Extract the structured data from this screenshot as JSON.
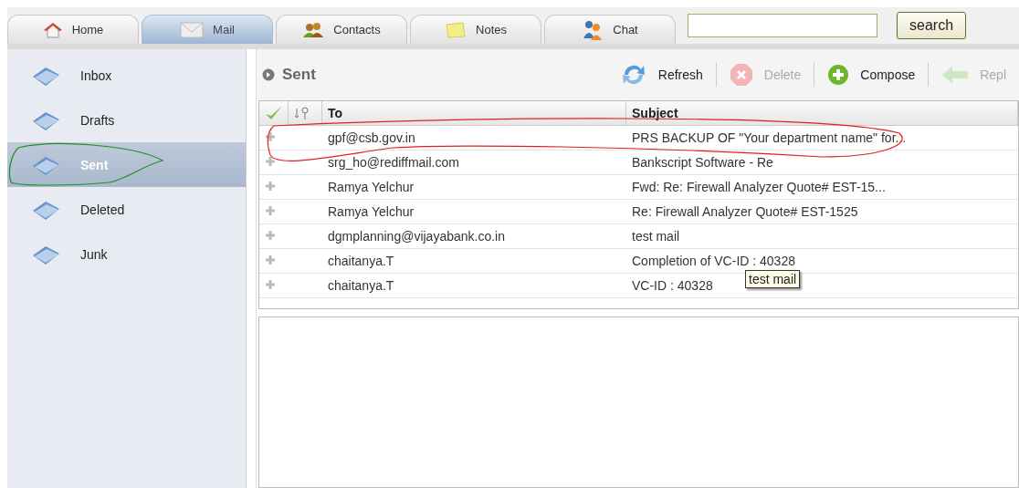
{
  "tabs": [
    {
      "label": "Home",
      "kind": "home",
      "selected": false
    },
    {
      "label": "Mail",
      "kind": "mail",
      "selected": true
    },
    {
      "label": "Contacts",
      "kind": "contacts",
      "selected": false
    },
    {
      "label": "Notes",
      "kind": "notes",
      "selected": false
    },
    {
      "label": "Chat",
      "kind": "chat",
      "selected": false
    }
  ],
  "search": {
    "button": "search"
  },
  "folders": [
    {
      "label": "Inbox",
      "selected": false
    },
    {
      "label": "Drafts",
      "selected": false
    },
    {
      "label": "Sent",
      "selected": true
    },
    {
      "label": "Deleted",
      "selected": false
    },
    {
      "label": "Junk",
      "selected": false
    }
  ],
  "panel_title": "Sent",
  "toolbar": [
    {
      "label": "Refresh",
      "kind": "refresh",
      "disabled": false
    },
    {
      "label": "Delete",
      "kind": "delete",
      "disabled": true
    },
    {
      "label": "Compose",
      "kind": "compose",
      "disabled": false
    },
    {
      "label": "Repl",
      "kind": "reply",
      "disabled": true
    }
  ],
  "table": {
    "columns": [
      "To",
      "Subject"
    ],
    "rows": [
      {
        "to": "gpf@csb.gov.in",
        "subject": "PRS BACKUP OF \"Your department name\" for..."
      },
      {
        "to": "srg_ho@rediffmail.com",
        "subject": "Bankscript Software - Re"
      },
      {
        "to": "Ramya Yelchur",
        "subject": "Fwd: Re: Firewall Analyzer Quote# EST-15..."
      },
      {
        "to": "Ramya Yelchur",
        "subject": "Re: Firewall Analyzer Quote# EST-1525"
      },
      {
        "to": "dgmplanning@vijayabank.co.in",
        "subject": "test mail"
      },
      {
        "to": "chaitanya.T",
        "subject": "Completion of VC-ID : 40328"
      },
      {
        "to": "chaitanya.T",
        "subject": "VC-ID : 40328"
      }
    ]
  },
  "tooltip": "test mail"
}
